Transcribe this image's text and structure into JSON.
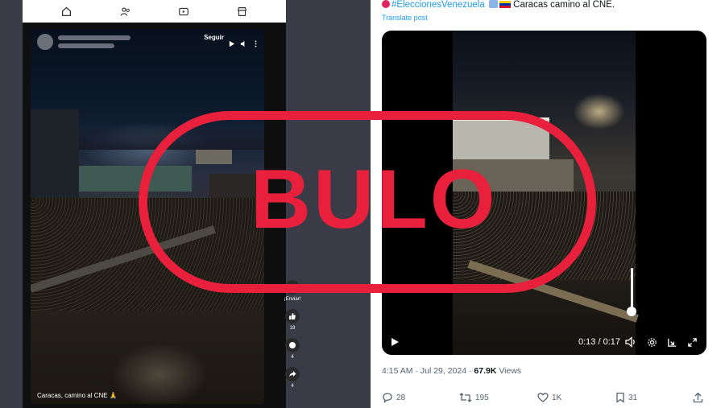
{
  "left": {
    "nav_icons": [
      "home-icon",
      "subscriptions-icon",
      "video-icon",
      "store-icon"
    ],
    "follow_label": "Seguir",
    "caption": "Caracas, camino al CNE 🙏",
    "actions": {
      "share_label": "¡Enviar!",
      "like_count": "19",
      "comment_count": "4",
      "forward_count": "4"
    }
  },
  "right": {
    "post": {
      "hashtag": "#EleccionesVenezuela",
      "text": "Caracas camino al CNE.",
      "translate": "Translate post"
    },
    "video": {
      "time": "0:13 / 0:17"
    },
    "meta": {
      "time": "4:15 AM · Jul 29, 2024 · ",
      "views_count": "67.9K",
      "views_label": " Views"
    },
    "stats": {
      "replies": "28",
      "reposts": "195",
      "likes": "1K",
      "bookmarks": "31"
    }
  },
  "stamp": {
    "text": "BULO",
    "color": "#e8203c"
  }
}
